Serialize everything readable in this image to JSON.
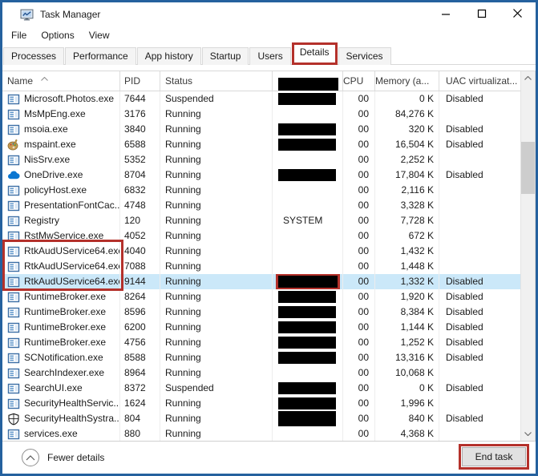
{
  "window": {
    "title": "Task Manager"
  },
  "titlebar": {
    "buttons": [
      {
        "name": "minimize",
        "glyph": "minimize-icon"
      },
      {
        "name": "maximize",
        "glyph": "maximize-icon"
      },
      {
        "name": "close",
        "glyph": "close-icon"
      }
    ]
  },
  "menubar": {
    "items": [
      "File",
      "Options",
      "View"
    ]
  },
  "tabs": {
    "items": [
      "Processes",
      "Performance",
      "App history",
      "Startup",
      "Users",
      "Details",
      "Services"
    ],
    "active": "Details"
  },
  "table": {
    "columns": [
      {
        "key": "name",
        "label": "Name",
        "sorted": "asc"
      },
      {
        "key": "pid",
        "label": "PID"
      },
      {
        "key": "status",
        "label": "Status"
      },
      {
        "key": "user",
        "label": "",
        "redacted": true
      },
      {
        "key": "cpu",
        "label": "CPU"
      },
      {
        "key": "mem",
        "label": "Memory (a..."
      },
      {
        "key": "uac",
        "label": "UAC virtualizat..."
      }
    ],
    "rows": [
      {
        "icon": "app",
        "name": "Microsoft.Photos.exe",
        "pid": "7644",
        "status": "Suspended",
        "user": "",
        "user_redacted": true,
        "cpu": "00",
        "mem": "0 K",
        "uac": "Disabled"
      },
      {
        "icon": "app",
        "name": "MsMpEng.exe",
        "pid": "3176",
        "status": "Running",
        "user": "",
        "user_redacted": false,
        "cpu": "00",
        "mem": "84,276 K",
        "uac": ""
      },
      {
        "icon": "app",
        "name": "msoia.exe",
        "pid": "3840",
        "status": "Running",
        "user": "",
        "user_redacted": true,
        "cpu": "00",
        "mem": "320 K",
        "uac": "Disabled"
      },
      {
        "icon": "paint",
        "name": "mspaint.exe",
        "pid": "6588",
        "status": "Running",
        "user": "",
        "user_redacted": true,
        "cpu": "00",
        "mem": "16,504 K",
        "uac": "Disabled"
      },
      {
        "icon": "app",
        "name": "NisSrv.exe",
        "pid": "5352",
        "status": "Running",
        "user": "",
        "user_redacted": false,
        "cpu": "00",
        "mem": "2,252 K",
        "uac": ""
      },
      {
        "icon": "cloud",
        "name": "OneDrive.exe",
        "pid": "8704",
        "status": "Running",
        "user": "",
        "user_redacted": true,
        "cpu": "00",
        "mem": "17,804 K",
        "uac": "Disabled"
      },
      {
        "icon": "app",
        "name": "policyHost.exe",
        "pid": "6832",
        "status": "Running",
        "user": "",
        "user_redacted": false,
        "cpu": "00",
        "mem": "2,116 K",
        "uac": ""
      },
      {
        "icon": "app",
        "name": "PresentationFontCac...",
        "pid": "4748",
        "status": "Running",
        "user": "",
        "user_redacted": false,
        "cpu": "00",
        "mem": "3,328 K",
        "uac": ""
      },
      {
        "icon": "app",
        "name": "Registry",
        "pid": "120",
        "status": "Running",
        "user": "SYSTEM",
        "user_redacted": false,
        "cpu": "00",
        "mem": "7,728 K",
        "uac": ""
      },
      {
        "icon": "app",
        "name": "RstMwService.exe",
        "pid": "4052",
        "status": "Running",
        "user": "",
        "user_redacted": false,
        "cpu": "00",
        "mem": "672 K",
        "uac": ""
      },
      {
        "icon": "app",
        "name": "RtkAudUService64.exe",
        "pid": "4040",
        "status": "Running",
        "user": "",
        "user_redacted": false,
        "cpu": "00",
        "mem": "1,432 K",
        "uac": ""
      },
      {
        "icon": "app",
        "name": "RtkAudUService64.exe",
        "pid": "7088",
        "status": "Running",
        "user": "",
        "user_redacted": false,
        "cpu": "00",
        "mem": "1,448 K",
        "uac": ""
      },
      {
        "icon": "app",
        "name": "RtkAudUService64.exe",
        "pid": "9144",
        "status": "Running",
        "user": "",
        "user_redacted": true,
        "cpu": "00",
        "mem": "1,332 K",
        "uac": "Disabled",
        "selected": true
      },
      {
        "icon": "app",
        "name": "RuntimeBroker.exe",
        "pid": "8264",
        "status": "Running",
        "user": "",
        "user_redacted": true,
        "cpu": "00",
        "mem": "1,920 K",
        "uac": "Disabled"
      },
      {
        "icon": "app",
        "name": "RuntimeBroker.exe",
        "pid": "8596",
        "status": "Running",
        "user": "",
        "user_redacted": true,
        "cpu": "00",
        "mem": "8,384 K",
        "uac": "Disabled"
      },
      {
        "icon": "app",
        "name": "RuntimeBroker.exe",
        "pid": "6200",
        "status": "Running",
        "user": "",
        "user_redacted": true,
        "cpu": "00",
        "mem": "1,144 K",
        "uac": "Disabled"
      },
      {
        "icon": "app",
        "name": "RuntimeBroker.exe",
        "pid": "4756",
        "status": "Running",
        "user": "",
        "user_redacted": true,
        "cpu": "00",
        "mem": "1,252 K",
        "uac": "Disabled"
      },
      {
        "icon": "app",
        "name": "SCNotification.exe",
        "pid": "8588",
        "status": "Running",
        "user": "",
        "user_redacted": true,
        "cpu": "00",
        "mem": "13,316 K",
        "uac": "Disabled"
      },
      {
        "icon": "app",
        "name": "SearchIndexer.exe",
        "pid": "8964",
        "status": "Running",
        "user": "",
        "user_redacted": false,
        "cpu": "00",
        "mem": "10,068 K",
        "uac": ""
      },
      {
        "icon": "app",
        "name": "SearchUI.exe",
        "pid": "8372",
        "status": "Suspended",
        "user": "",
        "user_redacted": true,
        "cpu": "00",
        "mem": "0 K",
        "uac": "Disabled"
      },
      {
        "icon": "app",
        "name": "SecurityHealthServic...",
        "pid": "1624",
        "status": "Running",
        "user": "",
        "user_redacted": true,
        "cpu": "00",
        "mem": "1,996 K",
        "uac": ""
      },
      {
        "icon": "shield",
        "name": "SecurityHealthSystra...",
        "pid": "804",
        "status": "Running",
        "user": "",
        "user_redacted": true,
        "user_redact_tall": true,
        "cpu": "00",
        "mem": "840 K",
        "uac": "Disabled"
      },
      {
        "icon": "app",
        "name": "services.exe",
        "pid": "880",
        "status": "Running",
        "user": "",
        "user_redacted": false,
        "cpu": "00",
        "mem": "4,368 K",
        "uac": ""
      }
    ]
  },
  "annotations": {
    "box_color": "#b4312b",
    "annotated_tab": "Details",
    "name_box_rows": {
      "start": 11,
      "end": 13
    },
    "user_cell_box_row": 13,
    "end_task_boxed": true
  },
  "footer": {
    "details_toggle": "Fewer details",
    "end_task": "End task"
  }
}
